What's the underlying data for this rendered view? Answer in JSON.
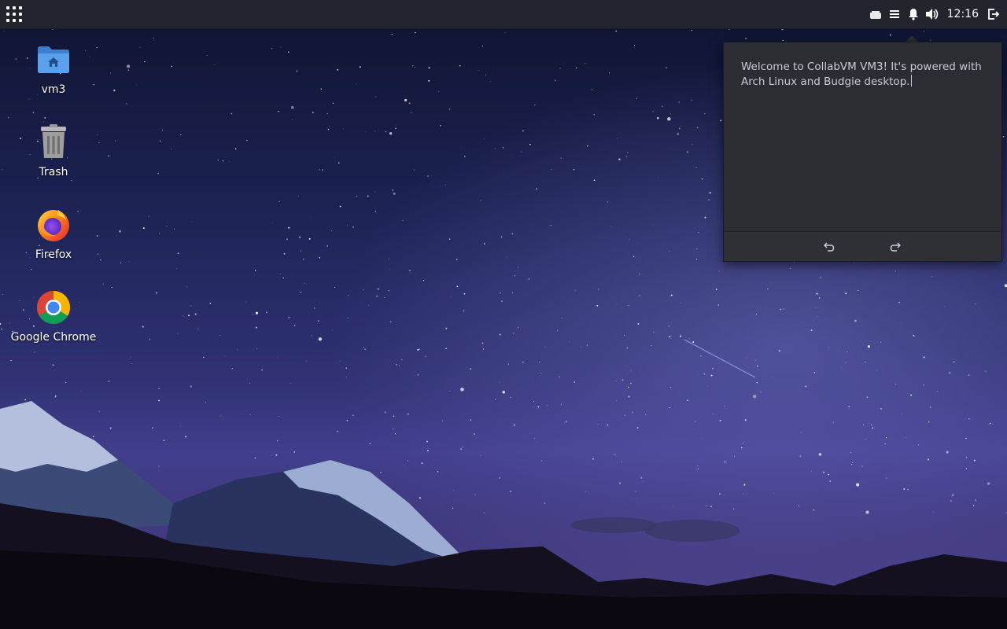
{
  "panel": {
    "clock": "12:16",
    "tray_icons": [
      "tray-app-icon",
      "list-icon",
      "bell-icon",
      "volume-icon"
    ],
    "power_icon": "logout-icon"
  },
  "desktop_icons": [
    {
      "label": "vm3",
      "icon": "home-folder-icon"
    },
    {
      "label": "Trash",
      "icon": "trash-icon"
    },
    {
      "label": "Firefox",
      "icon": "firefox-icon"
    },
    {
      "label": "Google Chrome",
      "icon": "chrome-icon"
    }
  ],
  "notes": {
    "text": "Welcome to CollabVM VM3! It's powered with Arch Linux and Budgie desktop.",
    "undo_icon": "undo-icon",
    "redo_icon": "redo-icon"
  },
  "colors": {
    "panel_bg": "#23252e",
    "popover_bg": "#2b2d33",
    "text_light": "#c9ccd2",
    "folder_blue": "#4a90d9"
  }
}
